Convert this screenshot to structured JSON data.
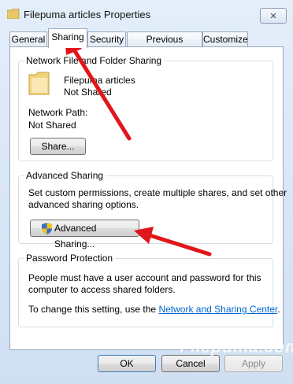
{
  "window": {
    "title": "Filepuma articles Properties",
    "close_glyph": "✕"
  },
  "tabs": [
    {
      "label": "General"
    },
    {
      "label": "Sharing"
    },
    {
      "label": "Security"
    },
    {
      "label": "Previous Versions"
    },
    {
      "label": "Customize"
    }
  ],
  "network_sharing": {
    "heading": "Network File and Folder Sharing",
    "folder_name": "Filepuma articles",
    "folder_status": "Not Shared",
    "path_label": "Network Path:",
    "path_value": "Not Shared",
    "share_button": "Share..."
  },
  "advanced_sharing": {
    "heading": "Advanced Sharing",
    "description_line1": "Set custom permissions, create multiple shares, and set other",
    "description_line2": "advanced sharing options.",
    "button": "Advanced Sharing..."
  },
  "password_protection": {
    "heading": "Password Protection",
    "line1": "People must have a user account and password for this",
    "line2": "computer to access shared folders.",
    "line3_prefix": "To change this setting, use the ",
    "link": "Network and Sharing Center",
    "line3_suffix": "."
  },
  "footer": {
    "ok": "OK",
    "cancel": "Cancel",
    "apply": "Apply"
  },
  "watermark": "Filepuma.com",
  "colors": {
    "annotation_arrow": "#e0161b",
    "link": "#0066cc",
    "window_bg": "#cfdff2"
  }
}
